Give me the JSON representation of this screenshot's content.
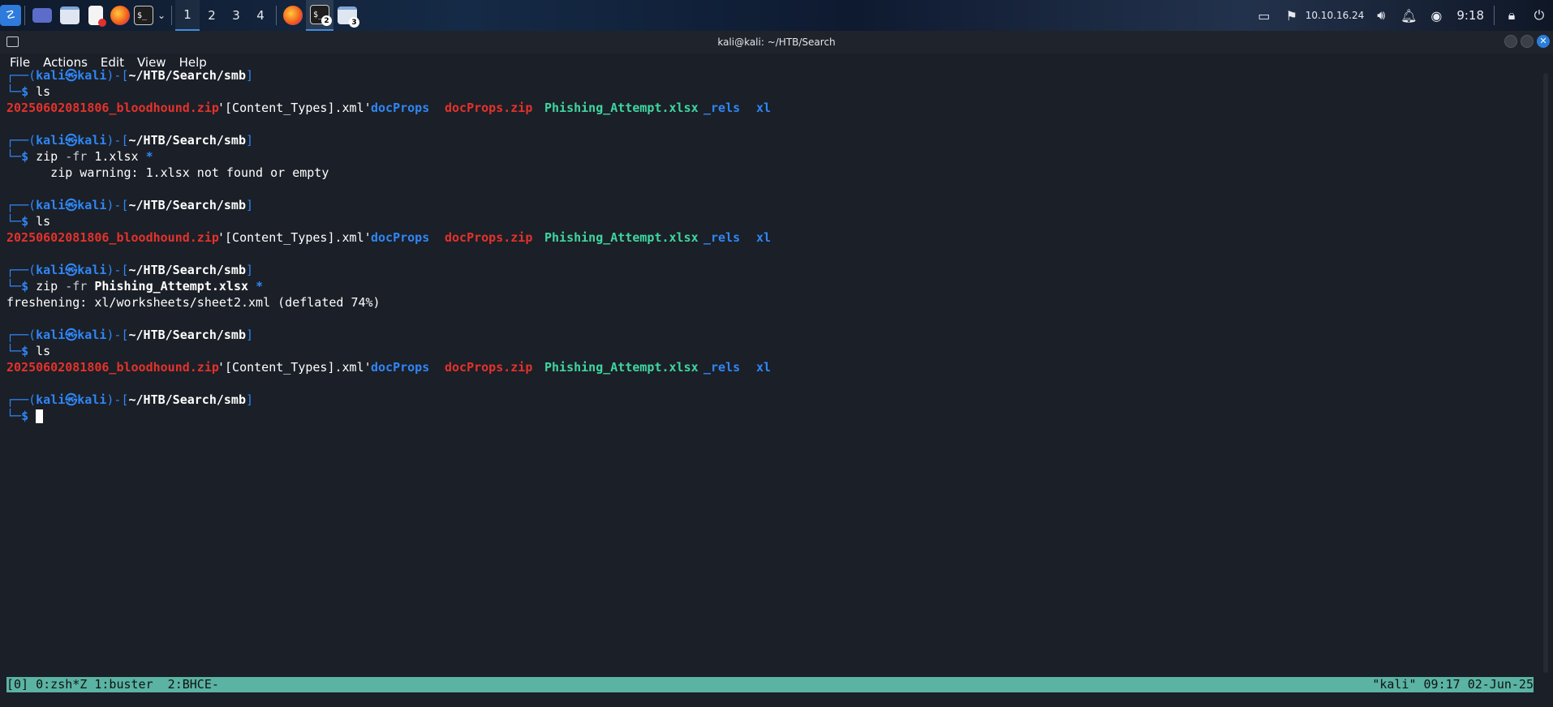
{
  "taskbar": {
    "workspaces": [
      "1",
      "2",
      "3",
      "4"
    ],
    "terminal_badge": "2",
    "files_badge": "3",
    "ip_address": "10.10.16.24",
    "clock": "9:18"
  },
  "window": {
    "title": "kali@kali: ~/HTB/Search"
  },
  "menu": [
    "File",
    "Actions",
    "Edit",
    "View",
    "Help"
  ],
  "terminal": {
    "prompt": {
      "open": "┌──(",
      "user": "kali",
      "at": "㉿",
      "host": "kali",
      "mid": ")-[",
      "path": "~/HTB/Search/smb",
      "close": "]",
      "second": "└─",
      "dollar": "$"
    },
    "ls_entries": [
      {
        "name": "20250602081806_bloodhound.zip",
        "kind": "archive"
      },
      {
        "name": "'[Content_Types].xml'",
        "kind": "file"
      },
      {
        "name": "docProps",
        "kind": "dir"
      },
      {
        "name": "docProps.zip",
        "kind": "archive"
      },
      {
        "name": "Phishing_Attempt.xlsx",
        "kind": "exec"
      },
      {
        "name": "_rels",
        "kind": "dir"
      },
      {
        "name": "xl",
        "kind": "dir"
      }
    ],
    "cmd_ls": "ls",
    "cmd2_bin": "zip",
    "cmd2_args": "-fr",
    "cmd2_target": "1.xlsx",
    "cmd2_glob": "*",
    "cmd2_output": "      zip warning: 1.xlsx not found or empty",
    "cmd4_bin": "zip",
    "cmd4_args": "-fr",
    "cmd4_target": "Phishing_Attempt.xlsx",
    "cmd4_glob": "*",
    "cmd4_output": "freshening: xl/worksheets/sheet2.xml (deflated 74%)"
  },
  "tmux": {
    "left": "[0] 0:zsh*Z 1:buster  2:BHCE-",
    "right": "\"kali\" 09:17 02-Jun-25"
  },
  "colors": {
    "background": "#1b1f27",
    "prompt_blue": "#2f86f5",
    "archive_red": "#e4322b",
    "exec_green": "#3fd6a0",
    "status_bar": "#5ab3a3"
  }
}
